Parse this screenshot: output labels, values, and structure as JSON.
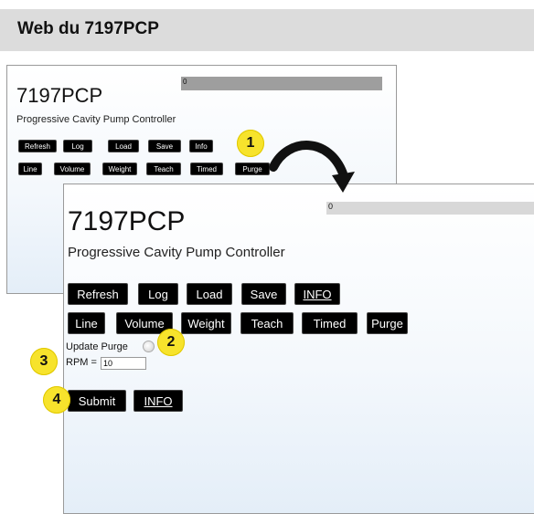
{
  "header": {
    "title": "Web du 7197PCP"
  },
  "back_panel": {
    "status_text": "0",
    "title": "7197PCP",
    "subtitle": "Progressive Cavity Pump Controller",
    "row1": [
      "Refresh",
      "Log",
      "Load",
      "Save",
      "Info"
    ],
    "row2": [
      "Line",
      "Volume",
      "Weight",
      "Teach",
      "Timed",
      "Purge"
    ]
  },
  "front_panel": {
    "status_text": "0",
    "title": "7197PCP",
    "subtitle": "Progressive Cavity Pump Controller",
    "row1": [
      "Refresh",
      "Log",
      "Load",
      "Save",
      "INFO"
    ],
    "row2": [
      "Line",
      "Volume",
      "Weight",
      "Teach",
      "Timed",
      "Purge"
    ],
    "update_label": "Update Purge",
    "rpm_label": "RPM =",
    "rpm_value": "10",
    "submit_label": "Submit",
    "info_label": "INFO"
  },
  "callouts": [
    "1",
    "2",
    "3",
    "4"
  ],
  "colors": {
    "badge": "#f7e32c",
    "button": "#000000",
    "header_band": "#dcdcdc"
  }
}
